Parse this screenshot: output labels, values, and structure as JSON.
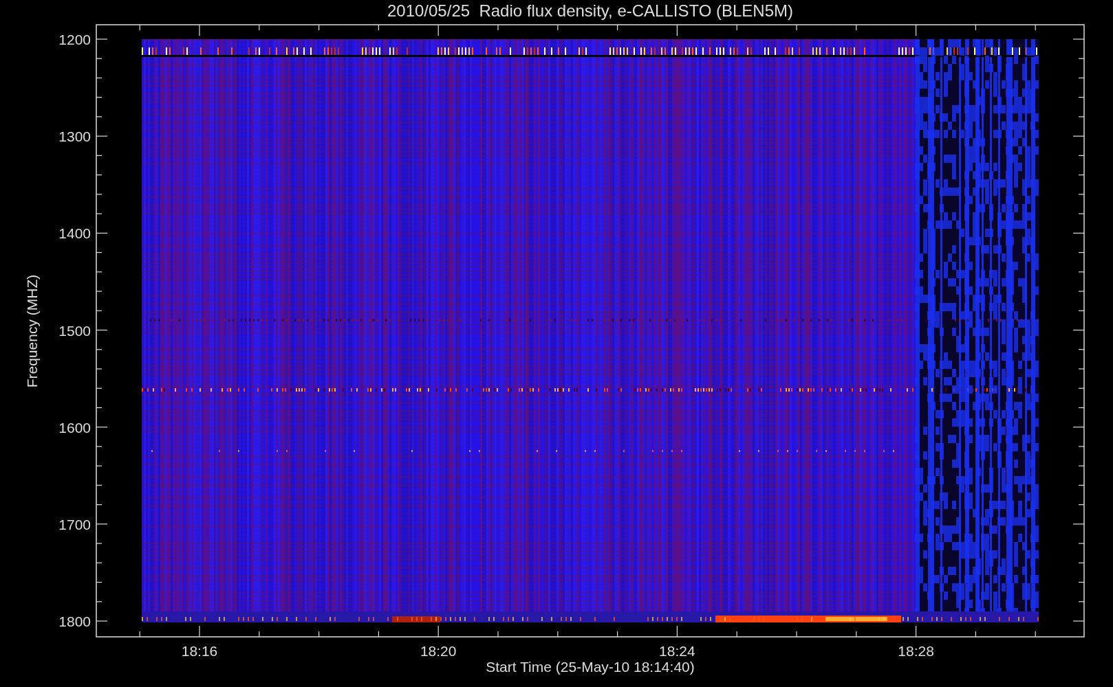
{
  "plot": {
    "title": "2010/05/25  Radio flux density, e-CALLISTO (BLEN5M)",
    "ylabel": "Frequency (MHZ)",
    "xlabel": "Start Time (25-May-10 18:14:40)",
    "yticks": [
      "1200",
      "1300",
      "1400",
      "1500",
      "1600",
      "1700",
      "1800"
    ],
    "xticks": [
      "18:16",
      "18:20",
      "18:24",
      "18:28"
    ]
  }
}
